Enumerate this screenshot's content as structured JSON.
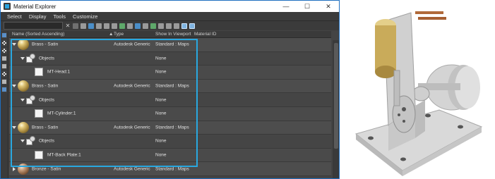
{
  "window": {
    "title": "Material Explorer",
    "minimize_label": "—",
    "maximize_label": "☐",
    "close_label": "✕"
  },
  "menu": [
    "Select",
    "Display",
    "Tools",
    "Customize"
  ],
  "toolbar": {
    "search_value": "",
    "clear_label": "✕"
  },
  "columns": {
    "name": "Name (Sorted Ascending)",
    "sort_marker": "▲",
    "type": "Type",
    "show_in_viewport": "Show In Viewport",
    "material_id": "Material ID"
  },
  "rows": [
    {
      "kind": "material",
      "name": "Brass - Satin",
      "type": "Autodesk Generic",
      "viewport": "Standard : Maps",
      "expanded": true
    },
    {
      "kind": "objects",
      "name": "Objects",
      "viewport": "None"
    },
    {
      "kind": "object",
      "name": "MT-Head:1",
      "viewport": "None"
    },
    {
      "kind": "material",
      "name": "Brass - Satin",
      "type": "Autodesk Generic",
      "viewport": "Standard : Maps",
      "expanded": true
    },
    {
      "kind": "objects",
      "name": "Objects",
      "viewport": "None"
    },
    {
      "kind": "object",
      "name": "MT-Cylinder:1",
      "viewport": "None"
    },
    {
      "kind": "material",
      "name": "Brass - Satin",
      "type": "Autodesk Generic",
      "viewport": "Standard : Maps",
      "expanded": true
    },
    {
      "kind": "objects",
      "name": "Objects",
      "viewport": "None"
    },
    {
      "kind": "object",
      "name": "MT-Back Plate:1",
      "viewport": "None"
    },
    {
      "kind": "material",
      "name": "Bronze - Satin",
      "type": "Autodesk Generic",
      "viewport": "Standard : Maps",
      "expanded": false
    }
  ],
  "colors": {
    "accent": "#29a8e0",
    "panel_bg": "#444444",
    "brass": "#c9ab5a",
    "model_grey": "#cfcfcf"
  }
}
